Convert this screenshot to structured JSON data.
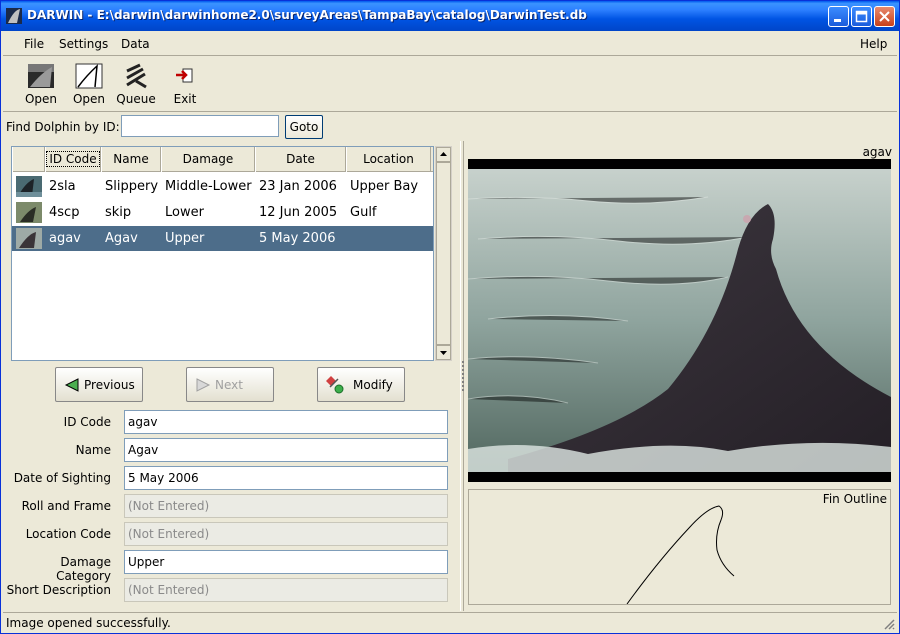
{
  "window": {
    "title": "DARWIN - E:\\darwin\\darwinhome2.0\\surveyAreas\\TampaBay\\catalog\\DarwinTest.db",
    "icon": "fin-icon"
  },
  "menu": {
    "file": "File",
    "settings": "Settings",
    "data": "Data",
    "help": "Help"
  },
  "toolbar": {
    "open_image": "Open",
    "open_trace": "Open",
    "queue": "Queue",
    "exit": "Exit"
  },
  "find": {
    "label": "Find Dolphin by ID:",
    "value": "",
    "goto": "Goto"
  },
  "table": {
    "columns": [
      "ID Code",
      "Name",
      "Damage",
      "Date",
      "Location"
    ],
    "rows": [
      {
        "id": "2sla",
        "name": "Slippery",
        "damage": "Middle-Lower",
        "date": "23 Jan 2006",
        "location": "Upper Bay"
      },
      {
        "id": "4scp",
        "name": "skip",
        "damage": "Lower",
        "date": "12 Jun 2005",
        "location": "Gulf"
      },
      {
        "id": "agav",
        "name": "Agav",
        "damage": "Upper",
        "date": "5 May 2006",
        "location": ""
      }
    ],
    "selected_index": 2
  },
  "nav": {
    "previous": "Previous",
    "next": "Next",
    "modify": "Modify"
  },
  "fields": [
    {
      "label": "ID Code",
      "value": "agav",
      "enabled": true
    },
    {
      "label": "Name",
      "value": "Agav",
      "enabled": true
    },
    {
      "label": "Date of Sighting",
      "value": "5 May 2006",
      "enabled": true
    },
    {
      "label": "Roll and Frame",
      "value": "(Not Entered)",
      "enabled": false
    },
    {
      "label": "Location Code",
      "value": "(Not Entered)",
      "enabled": false
    },
    {
      "label": "Damage Category",
      "value": "Upper",
      "enabled": true
    },
    {
      "label": "Short Description",
      "value": "(Not Entered)",
      "enabled": false
    }
  ],
  "image_panel": {
    "title": "agav"
  },
  "outline_panel": {
    "title": "Fin Outline"
  },
  "status": {
    "text": "Image opened successfully."
  },
  "colors": {
    "titlebar": "#0054e3",
    "selection": "#4d6d8a",
    "window_bg": "#ece9d8"
  }
}
